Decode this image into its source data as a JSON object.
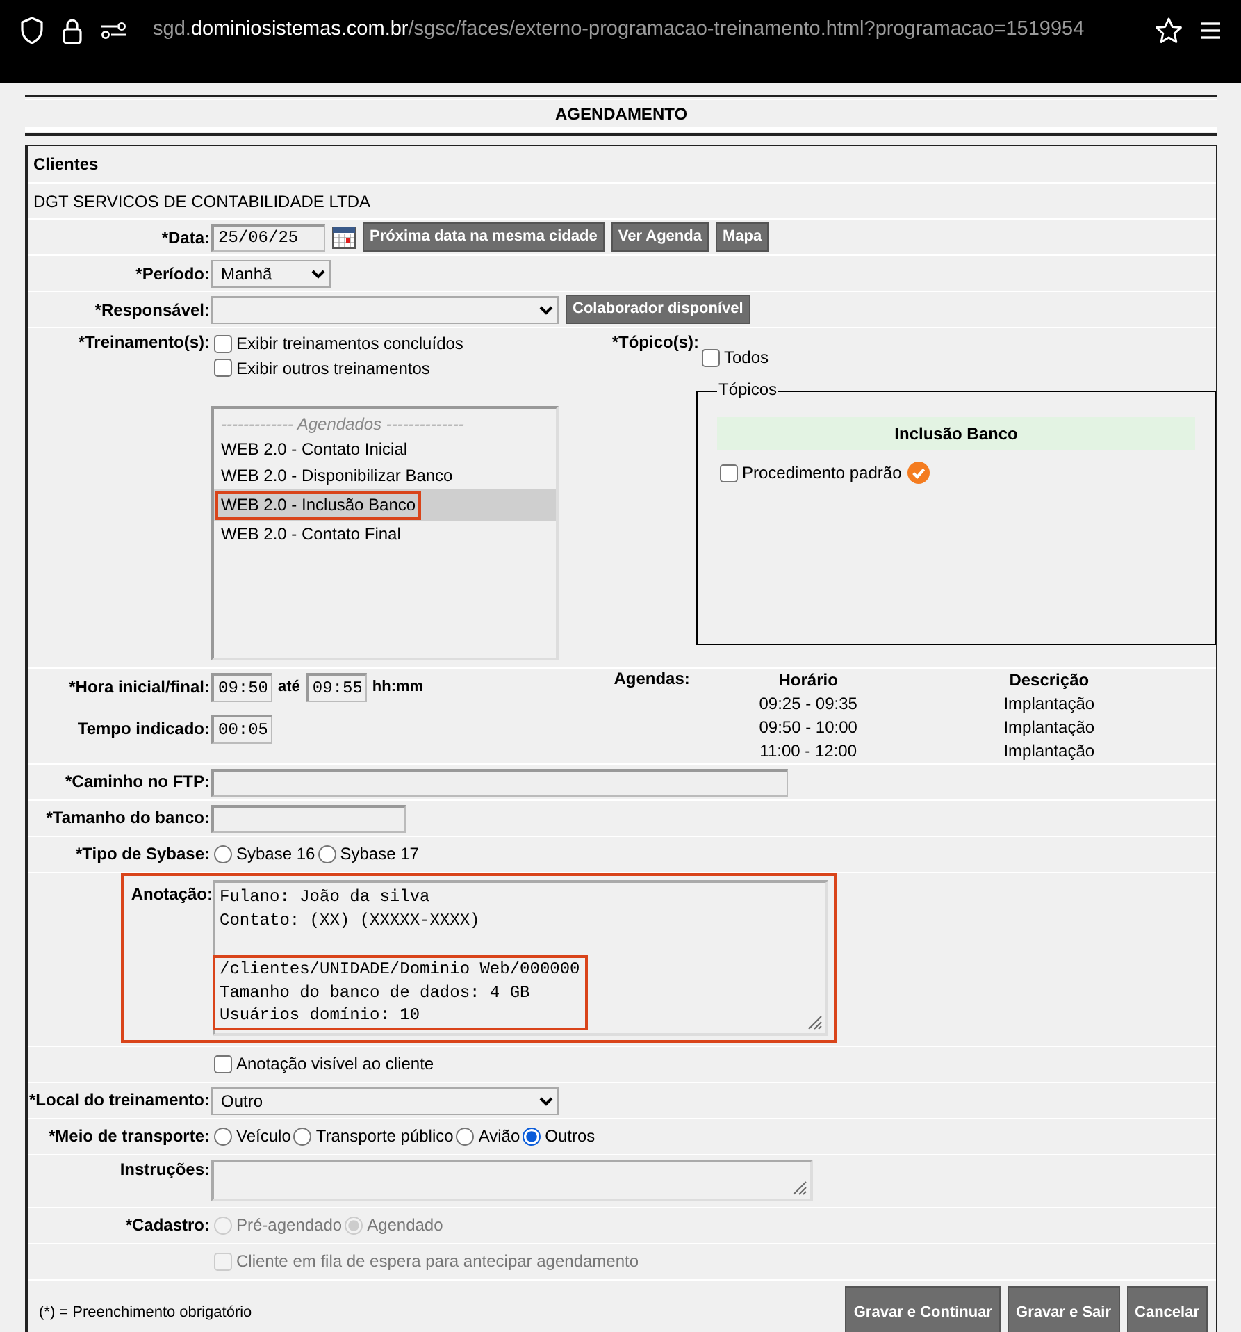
{
  "browser": {
    "url_prefix": "sgd.",
    "url_domain": "dominiosistemas.com.br",
    "url_path": "/sgsc/faces/externo-programacao-treinamento.html?programacao=1519954"
  },
  "title": "AGENDAMENTO",
  "client": {
    "heading": "Clientes",
    "name": "DGT SERVICOS DE CONTABILIDADE LTDA"
  },
  "date": {
    "label": "*Data:",
    "value": "25/06/25",
    "buttons": [
      "Próxima data na mesma cidade",
      "Ver Agenda",
      "Mapa"
    ]
  },
  "period": {
    "label": "*Período:",
    "value": "Manhã"
  },
  "responsible": {
    "label": "*Responsável:",
    "button": "Colaborador disponível"
  },
  "trainings": {
    "label": "*Treinamento(s):",
    "options": [
      {
        "label": "Exibir treinamentos concluídos",
        "checked": false
      },
      {
        "label": "Exibir outros treinamentos",
        "checked": false
      }
    ],
    "group": "------------- Agendados --------------",
    "items": [
      {
        "label": "WEB 2.0 - Contato Inicial",
        "selected": false,
        "highlighted": false
      },
      {
        "label": "WEB 2.0 - Disponibilizar Banco",
        "selected": false,
        "highlighted": false
      },
      {
        "label": "WEB 2.0 - Inclusão Banco",
        "selected": true,
        "highlighted": true
      },
      {
        "label": "WEB 2.0 - Contato Final",
        "selected": false,
        "highlighted": false
      }
    ]
  },
  "topics": {
    "label": "*Tópico(s):",
    "all": {
      "label": "Todos",
      "checked": false
    },
    "legend": "Tópicos",
    "heading": "Inclusão Banco",
    "items": [
      {
        "label": "Procedimento padrão",
        "checked": false,
        "done": true
      }
    ]
  },
  "time": {
    "label": "*Hora inicial/final:",
    "start": "09:50",
    "sep": "até",
    "end": "09:55",
    "hint": "hh:mm",
    "duration_label": "Tempo indicado:",
    "duration": "00:05"
  },
  "agendas": {
    "label": "Agendas:",
    "columns": [
      "Horário",
      "Descrição"
    ],
    "rows": [
      [
        "09:25 - 09:35",
        "Implantação"
      ],
      [
        "09:50 - 10:00",
        "Implantação"
      ],
      [
        "11:00 - 12:00",
        "Implantação"
      ]
    ]
  },
  "ftp": {
    "label": "*Caminho no FTP:"
  },
  "db_size": {
    "label": "*Tamanho do banco:"
  },
  "sybase": {
    "label": "*Tipo de Sybase:",
    "options": [
      {
        "label": "Sybase 16",
        "selected": false
      },
      {
        "label": "Sybase 17",
        "selected": false
      }
    ]
  },
  "note": {
    "label": "Anotação:",
    "highlighted": true,
    "blocks": [
      {
        "lines": [
          "Fulano: João da silva",
          "Contato: (XX) (XXXXX-XXXX)"
        ],
        "highlighted": false
      },
      {
        "lines": [
          "/clientes/UNIDADE/Dominio Web/000000",
          "Tamanho do banco de dados: 4 GB",
          "Usuários domínio: 10"
        ],
        "highlighted": true
      }
    ]
  },
  "note_visible": {
    "label": "Anotação visível ao cliente",
    "checked": false
  },
  "location": {
    "label": "*Local do treinamento:",
    "value": "Outro"
  },
  "transport": {
    "label": "*Meio de transporte:",
    "options": [
      {
        "label": "Veículo",
        "selected": false
      },
      {
        "label": "Transporte público",
        "selected": false
      },
      {
        "label": "Avião",
        "selected": false
      },
      {
        "label": "Outros",
        "selected": true
      }
    ]
  },
  "instructions": {
    "label": "Instruções:"
  },
  "registration": {
    "label": "*Cadastro:",
    "disabled": true,
    "options": [
      {
        "label": "Pré-agendado",
        "selected": false
      },
      {
        "label": "Agendado",
        "selected": true
      }
    ]
  },
  "waitlist": {
    "label": "Cliente em fila de espera para antecipar agendamento",
    "checked": false,
    "disabled": true
  },
  "footer": {
    "note": "(*) = Preenchimento obrigatório",
    "buttons": [
      "Gravar e Continuar",
      "Gravar e Sair",
      "Cancelar"
    ]
  }
}
